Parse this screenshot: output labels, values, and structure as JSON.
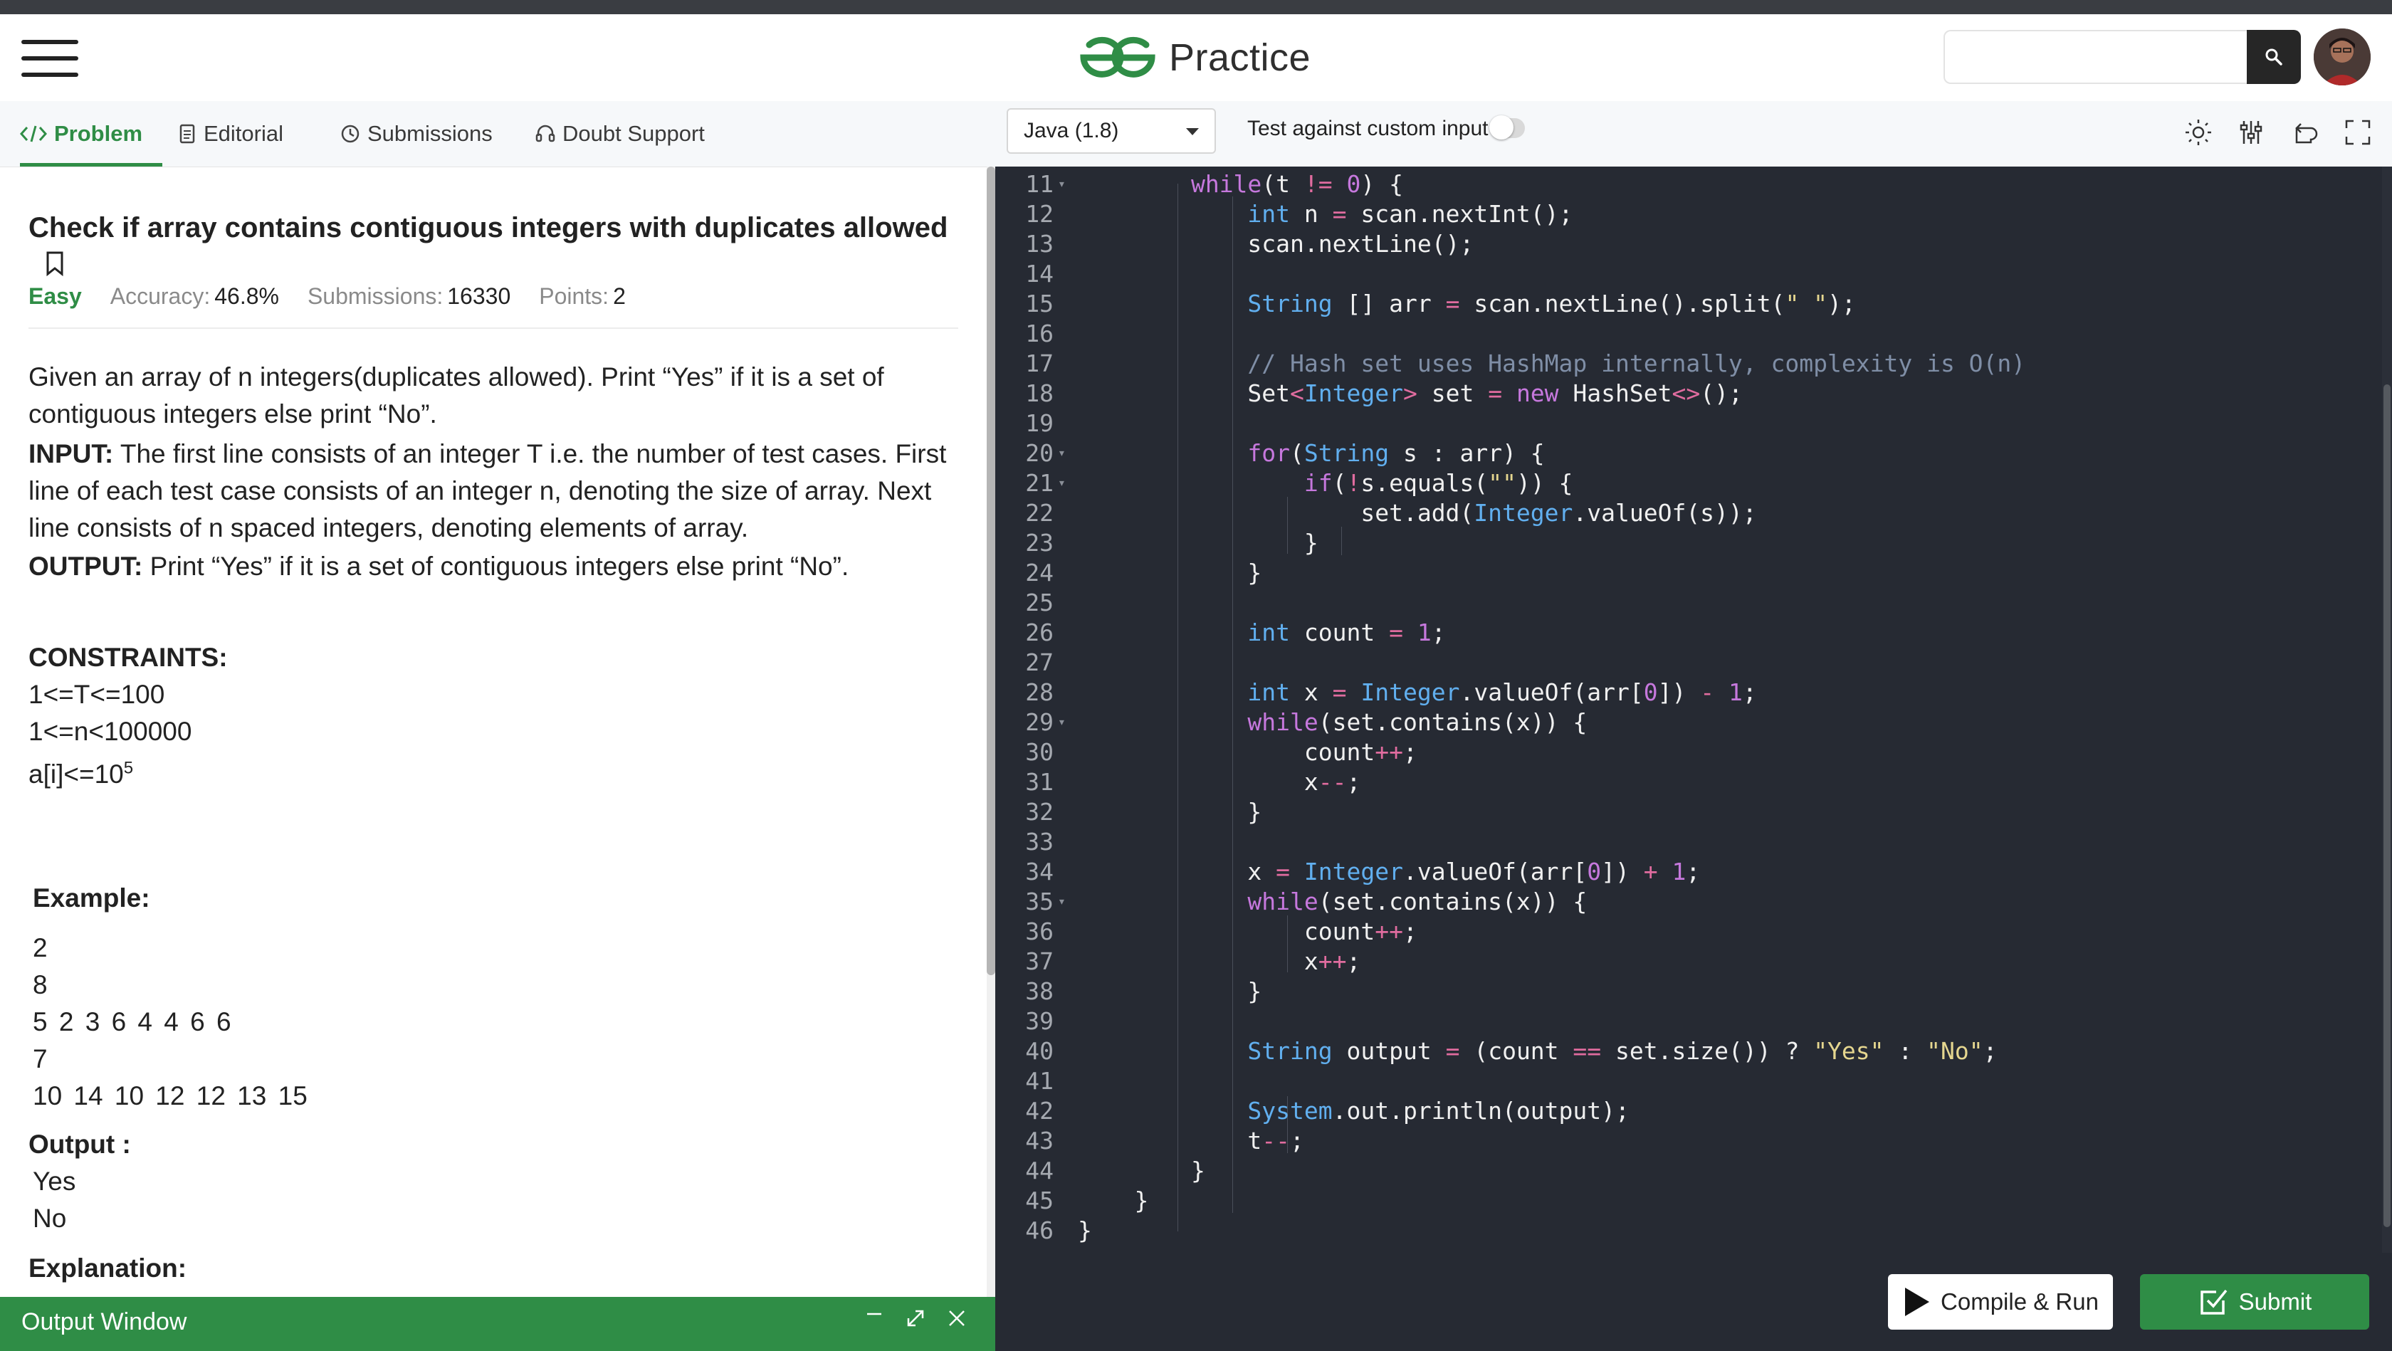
{
  "header": {
    "brand_text": "Practice",
    "search_placeholder": ""
  },
  "tabs": [
    {
      "label": "Problem",
      "icon": "code-icon",
      "active": true
    },
    {
      "label": "Editorial",
      "icon": "document-icon"
    },
    {
      "label": "Submissions",
      "icon": "clock-icon"
    },
    {
      "label": "Doubt Support",
      "icon": "headset-icon"
    }
  ],
  "problem": {
    "title": "Check if array contains contiguous integers with duplicates allowed",
    "difficulty": "Easy",
    "accuracy_label": "Accuracy:",
    "accuracy": "46.8%",
    "submissions_label": "Submissions:",
    "submissions": "16330",
    "points_label": "Points:",
    "points": "2",
    "description": "Given an array of n integers(duplicates allowed). Print “Yes” if it is a set of contiguous integers else print “No”.",
    "input_label": "INPUT:",
    "input_text": " The first line consists of an integer T i.e. the number of test cases. First line of each test case consists of an integer n, denoting the size of array. Next line consists of n spaced integers, denoting elements of array.",
    "output_label": "OUTPUT:",
    "output_text": "  Print “Yes” if it is a set of contiguous integers else print “No”.",
    "constraints_label": "CONSTRAINTS:",
    "constraint_1": "1<=T<=100",
    "constraint_2": "1<=n<100000",
    "constraint_3_base": "a[i]<=10",
    "constraint_3_exp": "5",
    "example_label": "Example:",
    "example_lines": [
      "2",
      "8",
      "5 2 3 6 4 4 6 6",
      "7",
      "10 14 10 12 12 13 15"
    ],
    "example_output_label": "Output :",
    "example_output_lines": [
      "Yes",
      "No"
    ],
    "explanation_label": "Explanation:"
  },
  "output_window": {
    "title": "Output Window"
  },
  "editor": {
    "language": "Java (1.8)",
    "custom_input_label": "Test against custom input",
    "line_numbers": [
      "11",
      "12",
      "13",
      "14",
      "15",
      "16",
      "17",
      "18",
      "19",
      "20",
      "21",
      "22",
      "23",
      "24",
      "25",
      "26",
      "27",
      "28",
      "29",
      "30",
      "31",
      "32",
      "33",
      "34",
      "35",
      "36",
      "37",
      "38",
      "39",
      "40",
      "41",
      "42",
      "43",
      "44",
      "45",
      "46"
    ]
  },
  "actions": {
    "compile_run": "Compile & Run",
    "submit": "Submit"
  },
  "colors": {
    "brand_green": "#2f8d46",
    "editor_bg": "#262a33"
  }
}
